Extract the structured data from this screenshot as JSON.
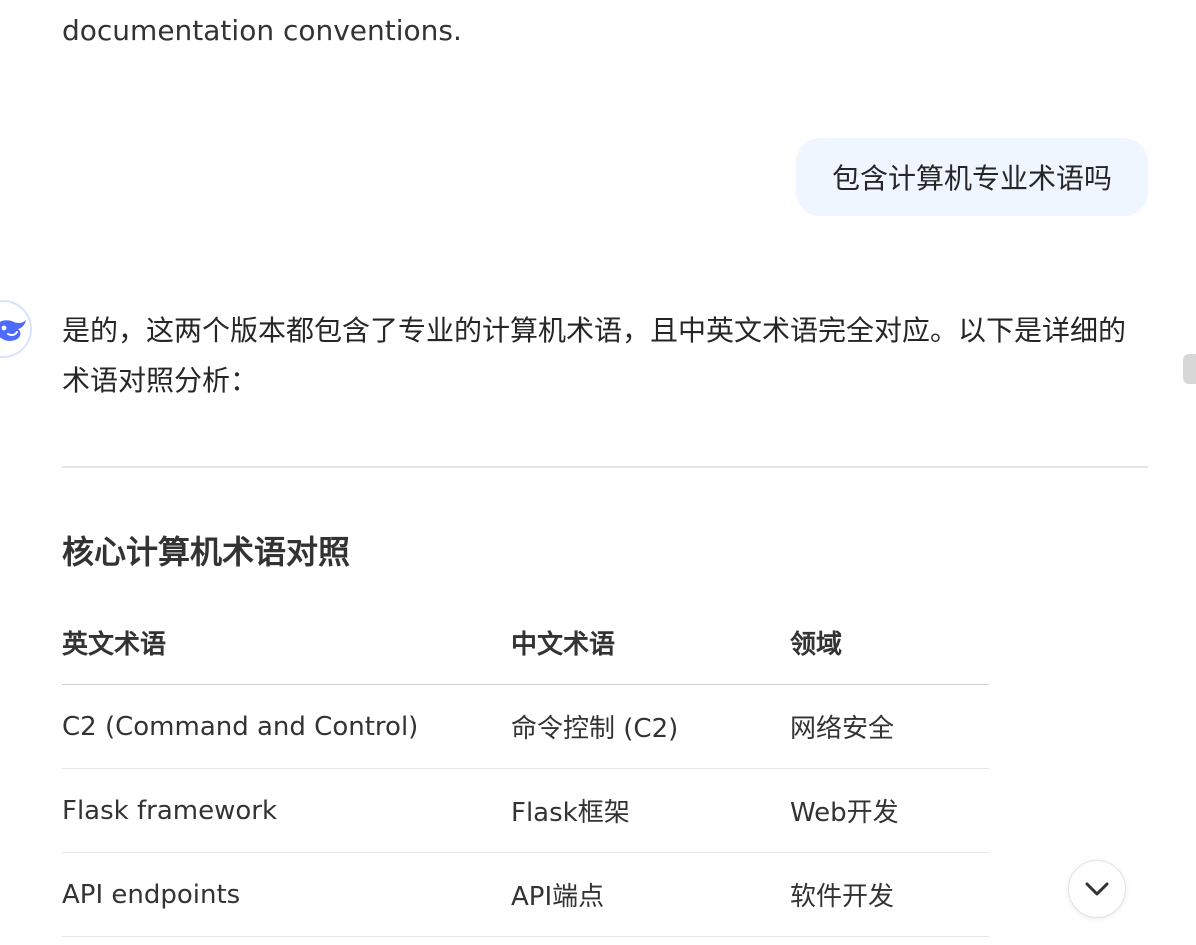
{
  "previous_message": {
    "text_tail": "documentation conventions."
  },
  "user_message": {
    "text": "包含计算机专业术语吗"
  },
  "assistant": {
    "avatar_icon": "deepseek-whale-icon",
    "intro": "是的，这两个版本都包含了专业的计算机术语，且中英文术语完全对应。以下是详细的术语对照分析：",
    "section_heading": "核心计算机术语对照",
    "table": {
      "headers": [
        "英文术语",
        "中文术语",
        "领域"
      ],
      "rows": [
        [
          "C2 (Command and Control)",
          "命令控制 (C2)",
          "网络安全"
        ],
        [
          "Flask framework",
          "Flask框架",
          "Web开发"
        ],
        [
          "API endpoints",
          "API端点",
          "软件开发"
        ]
      ]
    }
  },
  "controls": {
    "scroll_down_icon": "chevron-down-icon"
  },
  "colors": {
    "user_bubble_bg": "#eff6ff",
    "text": "#262626",
    "divider": "#e5e5e5",
    "icon_blue": "#4d6bfe"
  }
}
